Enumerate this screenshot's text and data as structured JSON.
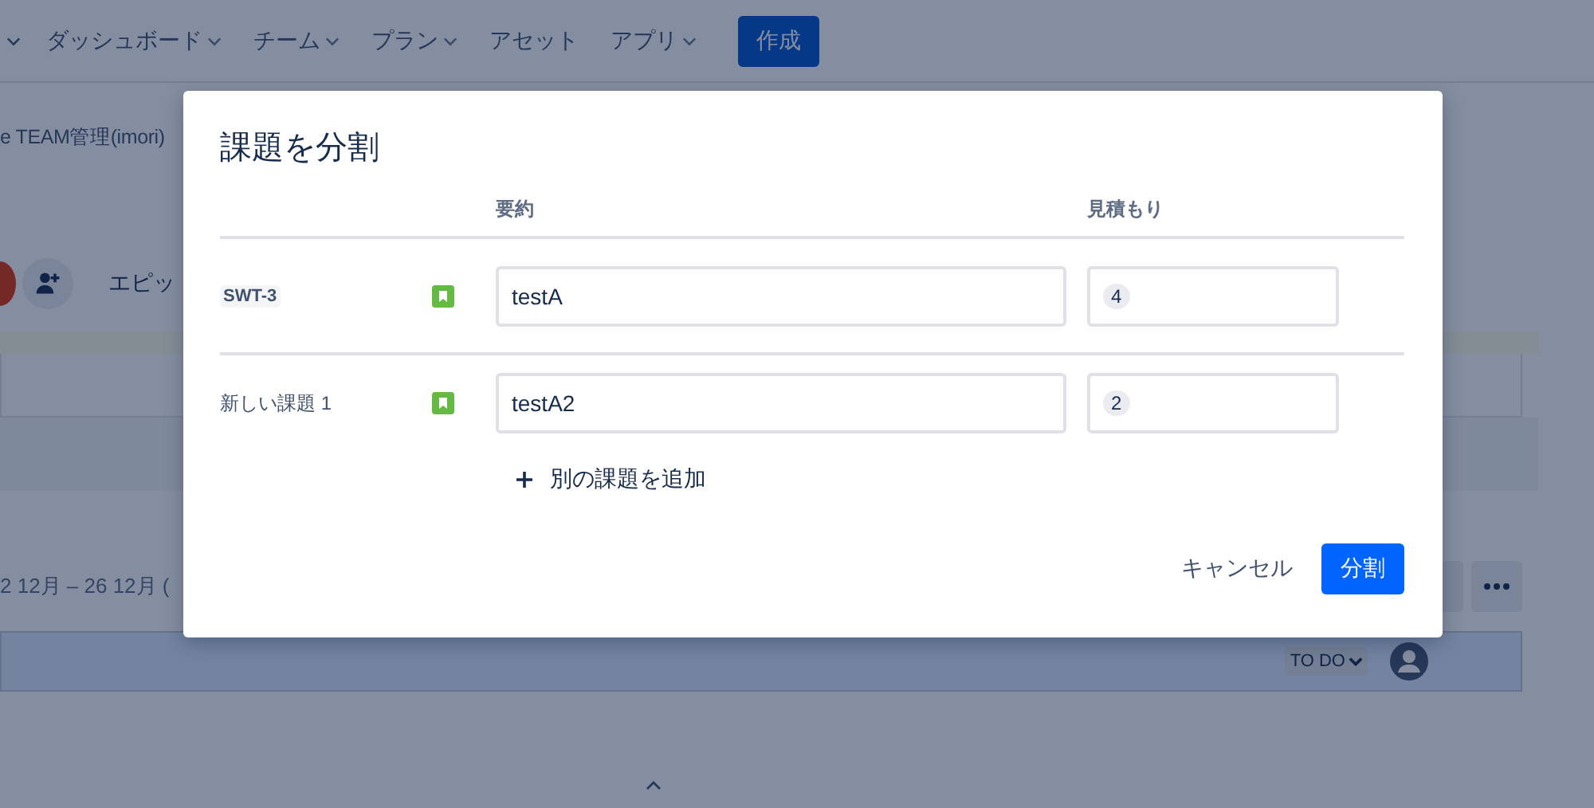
{
  "nav": {
    "items": [
      {
        "label": "ダッシュボード",
        "dropdown": true
      },
      {
        "label": "チーム",
        "dropdown": true
      },
      {
        "label": "プラン",
        "dropdown": true
      },
      {
        "label": "アセット",
        "dropdown": false
      },
      {
        "label": "アプリ",
        "dropdown": true
      }
    ],
    "create_button": "作成"
  },
  "breadcrumb": "e TEAM管理(imori)",
  "toolbar": {
    "tab_label": "エピッ"
  },
  "sprint": {
    "dates": "2 12月 – 26 12月 ("
  },
  "issue_row": {
    "status": "TO DO"
  },
  "dialog": {
    "title": "課題を分割",
    "columns": [
      "要約",
      "見積もり"
    ],
    "rows": [
      {
        "kind": "original",
        "key": "SWT-3",
        "summary": "testA",
        "estimate": "4"
      },
      {
        "kind": "new",
        "key": "新しい課題 1",
        "summary": "testA2",
        "estimate": "2"
      }
    ],
    "add_link": "別の課題を追加",
    "buttons": [
      {
        "label": "キャンセル",
        "kind": "subtle"
      },
      {
        "label": "分割",
        "kind": "primary"
      }
    ]
  }
}
